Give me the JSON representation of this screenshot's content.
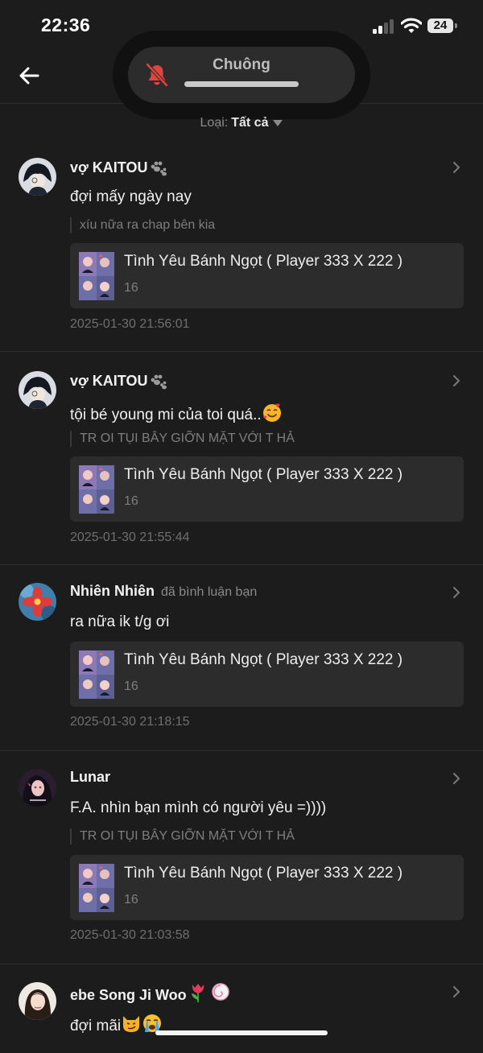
{
  "status": {
    "time": "22:36",
    "battery": "24"
  },
  "header": {
    "ringer_label": "Chuông"
  },
  "filter": {
    "label": "Loại:",
    "value": "Tất cả"
  },
  "items": [
    {
      "user": "vợ KAITOU",
      "action": "",
      "comment": "đợi mấy ngày nay",
      "quote": "xíu nữa ra chap bên kia",
      "card_title": "Tình Yêu Bánh Ngọt ( Player 333 X 222 )",
      "card_count": "16",
      "time": "2025-01-30 21:56:01"
    },
    {
      "user": "vợ KAITOU",
      "action": "",
      "comment": "tội bé young mi của toi quá..",
      "quote": "TR OI TỤI BÂY GIỠN MẶT VỚI T HẢ",
      "card_title": "Tình Yêu Bánh Ngọt ( Player 333 X 222 )",
      "card_count": "16",
      "time": "2025-01-30 21:55:44"
    },
    {
      "user": "Nhiên Nhiên",
      "action": "đã bình luận bạn",
      "comment": "ra nữa ik t/g ơi",
      "quote": "",
      "card_title": "Tình Yêu Bánh Ngọt ( Player 333 X 222 )",
      "card_count": "16",
      "time": "2025-01-30 21:18:15"
    },
    {
      "user": "Lunar",
      "action": "",
      "comment": "F.A. nhìn bạn mình có người yêu =))))",
      "quote": "TR OI TỤI BÂY GIỠN MẶT VỚI T HẢ",
      "card_title": "Tình Yêu Bánh Ngọt ( Player 333 X 222 )",
      "card_count": "16",
      "time": "2025-01-30 21:03:58"
    },
    {
      "user": "ebe Song Ji Woo",
      "action": "",
      "comment": "đợi mãi",
      "quote": "",
      "card_title": "",
      "card_count": "",
      "time": ""
    }
  ],
  "colors": {
    "background": "#1c1c1c",
    "card": "#2c2c2c",
    "muted": "#7e7e7e",
    "mute_icon": "#e0443e"
  }
}
